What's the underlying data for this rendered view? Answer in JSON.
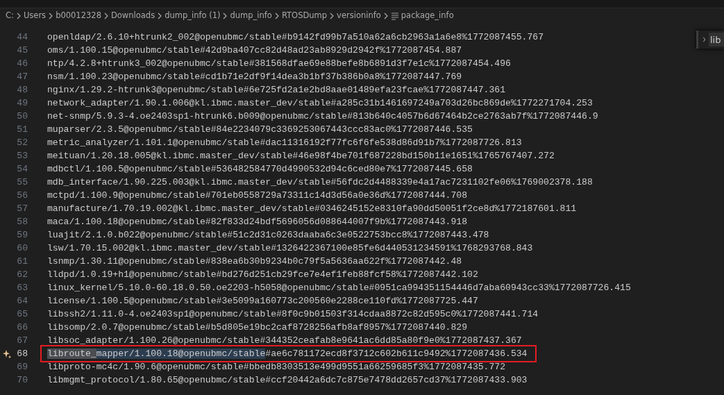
{
  "breadcrumb": [
    "C:",
    "Users",
    "b00012328",
    "Downloads",
    "dump_info (1)",
    "dump_info",
    "RTOSDump",
    "versioninfo",
    "package_info"
  ],
  "lines": [
    {
      "number": "44",
      "text": "openldap/2.6.10+htrunk2_002@openubmc/stable#b9142fd99b7a510a62a6cb2963a1a6e8%1772087455.767",
      "current": false,
      "boxed": false,
      "ai_hint": false
    },
    {
      "number": "45",
      "text": "oms/1.100.15@openubmc/stable#42d9ba407cc82d48ad23ab8929d2942f%1772087454.887",
      "current": false,
      "boxed": false,
      "ai_hint": false
    },
    {
      "number": "46",
      "text": "ntp/4.2.8+htrunk3_002@openubmc/stable#381568dfae69e88befe8b6891d3f7e1c%1772087454.496",
      "current": false,
      "boxed": false,
      "ai_hint": false
    },
    {
      "number": "47",
      "text": "nsm/1.100.23@openubmc/stable#cd1b71e2df9f14dea3b1bf37b386b0a8%1772087447.769",
      "current": false,
      "boxed": false,
      "ai_hint": false
    },
    {
      "number": "48",
      "text": "nginx/1.29.2-htrunk3@openubmc/stable#6e725fd2a1e2bd8aae01489efa23fcae%1772087447.361",
      "current": false,
      "boxed": false,
      "ai_hint": false
    },
    {
      "number": "49",
      "text": "network_adapter/1.90.1.006@kl.ibmc.master_dev/stable#a285c31b1461697249a703d26bc869de%1772271704.253",
      "current": false,
      "boxed": false,
      "ai_hint": false
    },
    {
      "number": "50",
      "text": "net-snmp/5.9.3-4.oe2403sp1-htrunk6.b009@openubmc/stable#813b640c4057b6d67464b2ce2763ab7f%1772087446.9",
      "current": false,
      "boxed": false,
      "ai_hint": false
    },
    {
      "number": "51",
      "text": "muparser/2.3.5@openubmc/stable#84e2234079c3369253067443ccc83ac0%1772087446.535",
      "current": false,
      "boxed": false,
      "ai_hint": false
    },
    {
      "number": "52",
      "text": "metric_analyzer/1.101.1@openubmc/stable#dac11316192f77fc6f6fe538d86d91b7%1772087726.813",
      "current": false,
      "boxed": false,
      "ai_hint": false
    },
    {
      "number": "53",
      "text": "meituan/1.20.18.005@kl.ibmc.master_dev/stable#46e98f4be701f687228bd150b11e1651%1765767407.272",
      "current": false,
      "boxed": false,
      "ai_hint": false
    },
    {
      "number": "54",
      "text": "mdbctl/1.100.5@openubmc/stable#536482584770d4990532d94c6ced80e7%1772087445.658",
      "current": false,
      "boxed": false,
      "ai_hint": false
    },
    {
      "number": "55",
      "text": "mdb_interface/1.90.225.003@kl.ibmc.master_dev/stable#56fdc2d4488339e4a17ac7231102fe06%1769002378.188",
      "current": false,
      "boxed": false,
      "ai_hint": false
    },
    {
      "number": "56",
      "text": "mctpd/1.100.9@openubmc/stable#701eb0558729a73311c14d3d56a0e36d%1772087444.708",
      "current": false,
      "boxed": false,
      "ai_hint": false
    },
    {
      "number": "57",
      "text": "manufacture/1.70.19.002@kl.ibmc.master_dev/stable#0346245152e8310fa90dd50051f2ce8d%1772187601.811",
      "current": false,
      "boxed": false,
      "ai_hint": false
    },
    {
      "number": "58",
      "text": "maca/1.100.18@openubmc/stable#82f833d24bdf5696056d088644007f9b%1772087443.918",
      "current": false,
      "boxed": false,
      "ai_hint": false
    },
    {
      "number": "59",
      "text": "luajit/2.1.0.b022@openubmc/stable#51c2d31c0263daaba6c3e0522753bcc8%1772087443.478",
      "current": false,
      "boxed": false,
      "ai_hint": false
    },
    {
      "number": "60",
      "text": "lsw/1.70.15.002@kl.ibmc.master_dev/stable#1326422367100e85fe6d440531234591%1768293768.843",
      "current": false,
      "boxed": false,
      "ai_hint": false
    },
    {
      "number": "61",
      "text": "lsnmp/1.30.11@openubmc/stable#838ea6b30b9234b0c79f5a5636aa622f%1772087442.48",
      "current": false,
      "boxed": false,
      "ai_hint": false
    },
    {
      "number": "62",
      "text": "lldpd/1.0.19+h1@openubmc/stable#bd276d251cb29fce7e4ef1feb88fcf58%1772087442.102",
      "current": false,
      "boxed": false,
      "ai_hint": false
    },
    {
      "number": "63",
      "text": "linux_kernel/5.10.0-60.18.0.50.oe2203-h5058@openubmc/stable#0951ca994351154446d7aba60943cc33%1772087726.415",
      "current": false,
      "boxed": false,
      "ai_hint": false
    },
    {
      "number": "64",
      "text": "license/1.100.5@openubmc/stable#3e5099a160773c200560e2288ce110fd%1772087725.447",
      "current": false,
      "boxed": false,
      "ai_hint": false
    },
    {
      "number": "65",
      "text": "libssh2/1.11.0-4.oe2403sp1@openubmc/stable#8f0c9b01503f314cdaa8872c82d595c0%1772087441.714",
      "current": false,
      "boxed": false,
      "ai_hint": false
    },
    {
      "number": "66",
      "text": "libsomp/2.0.7@openubmc/stable#b5d805e19bc2caf8728256afb8af8957%1772087440.829",
      "current": false,
      "boxed": false,
      "ai_hint": false
    },
    {
      "number": "67",
      "text": "libsoc_adapter/1.100.26@openubmc/stable#344352ceafab8e9641ac6dd85a80f9e0%1772087437.367",
      "current": false,
      "boxed": false,
      "ai_hint": false
    },
    {
      "number": "68",
      "current": true,
      "boxed": true,
      "ai_hint": true,
      "segments": [
        {
          "text": "libroute_",
          "kind": "word-highlight"
        },
        {
          "text": "mapper/1.100.18@openubmc/stable",
          "kind": "selection"
        },
        {
          "text": "#ae6c781172ecd8f3712c602b611c9492%1772087436.534",
          "kind": "plain"
        }
      ]
    },
    {
      "number": "69",
      "text": "libproto-mc4c/1.90.6@openubmc/stable#bbedb8303513e499d9551a66259685f3%1772087435.772",
      "current": false,
      "boxed": false,
      "ai_hint": false
    },
    {
      "number": "70",
      "text": "libmgmt_protocol/1.80.65@openubmc/stable#ccf20442a6dc7c875e7478dd2657cd37%1772087433.903",
      "current": false,
      "boxed": false,
      "ai_hint": false
    }
  ],
  "find_widget": {
    "value": "lib",
    "expanded": false
  }
}
